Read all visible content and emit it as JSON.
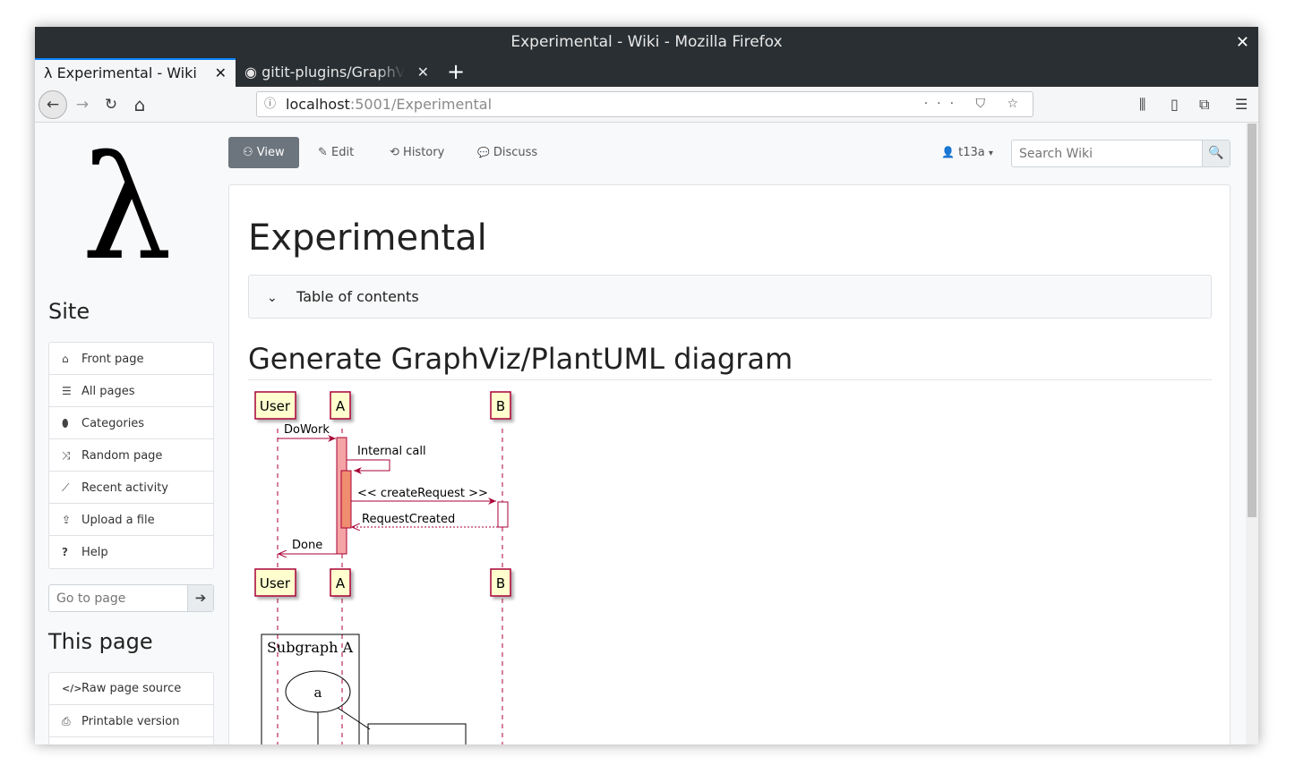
{
  "window": {
    "title": "Experimental - Wiki - Mozilla Firefox",
    "close_glyph": "✕"
  },
  "tabs": [
    {
      "icon": "λ",
      "label": "Experimental - Wiki",
      "close": "✕"
    },
    {
      "icon": "◉",
      "label": "gitit-plugins/GraphViz",
      "close": "✕"
    }
  ],
  "newtab_glyph": "+",
  "urlbar": {
    "host": "localhost",
    "path": ":5001/Experimental",
    "info_glyph": "ⓘ",
    "action_glyphs": "··· ⛉ ☆"
  },
  "navbar_icons": {
    "back": "←",
    "forward": "→",
    "reload": "↻",
    "home": "⌂",
    "library": "⫼",
    "sidebar": "▯",
    "screenshot": "⧉",
    "menu": "☰"
  },
  "sidebar": {
    "logo": "λ",
    "site_heading": "Site",
    "site_items": [
      {
        "icon": "⌂",
        "label": "Front page"
      },
      {
        "icon": "☰",
        "label": "All pages"
      },
      {
        "icon": "⬮",
        "label": "Categories"
      },
      {
        "icon": "⤨",
        "label": "Random page"
      },
      {
        "icon": "⟋",
        "label": "Recent activity"
      },
      {
        "icon": "⇪",
        "label": "Upload a file"
      },
      {
        "icon": "?",
        "label": "Help"
      }
    ],
    "goto_placeholder": "Go to page",
    "goto_button": "➔",
    "this_page_heading": "This page",
    "page_items": [
      {
        "icon": "</>",
        "label": "Raw page source"
      },
      {
        "icon": "⎙",
        "label": "Printable version"
      }
    ]
  },
  "topnav": {
    "view": {
      "icon": "⚇",
      "label": "View"
    },
    "edit": {
      "icon": "✎",
      "label": "Edit"
    },
    "history": {
      "icon": "⟲",
      "label": "History"
    },
    "discuss": {
      "icon": "💬",
      "label": "Discuss"
    },
    "user": {
      "icon": "👤",
      "label": "t13a",
      "caret": "▾"
    },
    "search_placeholder": "Search Wiki",
    "search_icon": "🔍"
  },
  "main": {
    "page_title": "Experimental",
    "toc_label": "Table of contents",
    "toc_chevron": "⌄",
    "section_heading": "Generate GraphViz/PlantUML diagram"
  },
  "sequence_diagram": {
    "participants": [
      "User",
      "A",
      "B"
    ],
    "messages": [
      "DoWork",
      "Internal call",
      "<< createRequest >>",
      "RequestCreated",
      "Done"
    ]
  },
  "graphviz": {
    "cluster_label": "Subgraph A",
    "node_label": "a"
  },
  "colors": {
    "participant_fill": "#fefece",
    "participant_stroke": "#a80036",
    "activation_fill": "#f4a4a4",
    "activation_inner": "#f08c70",
    "view_button": "#6c757d"
  }
}
